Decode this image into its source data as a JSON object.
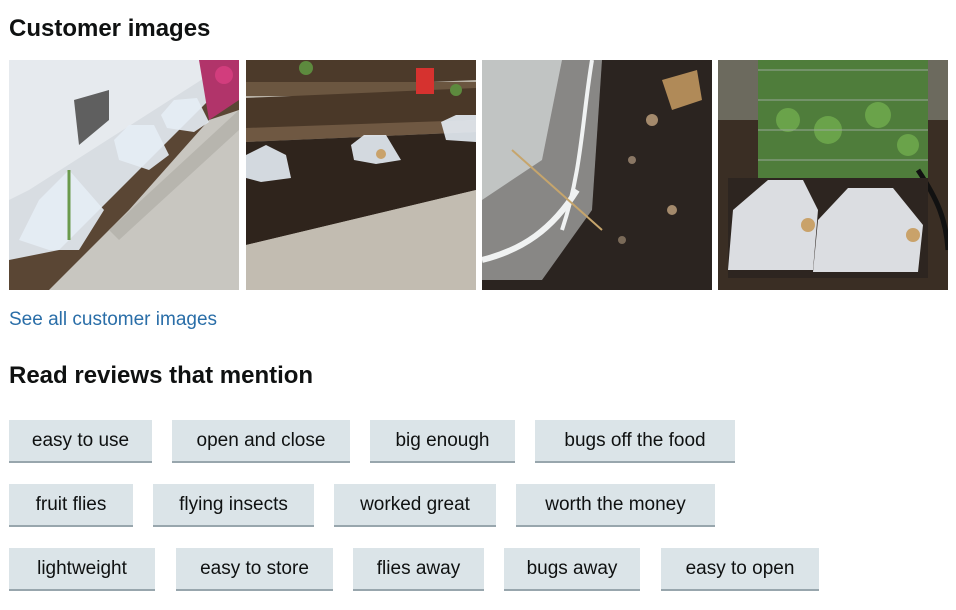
{
  "customer_images": {
    "title": "Customer images",
    "see_all_label": "See all customer images",
    "images": [
      {
        "description": "mesh covers along wall"
      },
      {
        "description": "mesh covers in raised bed"
      },
      {
        "description": "mesh netting close-up"
      },
      {
        "description": "mesh covers near pea trellis"
      }
    ]
  },
  "mentions": {
    "title": "Read reviews that mention",
    "chips": [
      "easy to use",
      "open and close",
      "big enough",
      "bugs off the food",
      "fruit flies",
      "flying insects",
      "worked great",
      "worth the money",
      "lightweight",
      "easy to store",
      "flies away",
      "bugs away",
      "easy to open"
    ]
  },
  "colors": {
    "link": "#2a6ea8",
    "chip_background": "#dbe4e8",
    "chip_border": "#98a6ad",
    "text": "#0f1111"
  }
}
